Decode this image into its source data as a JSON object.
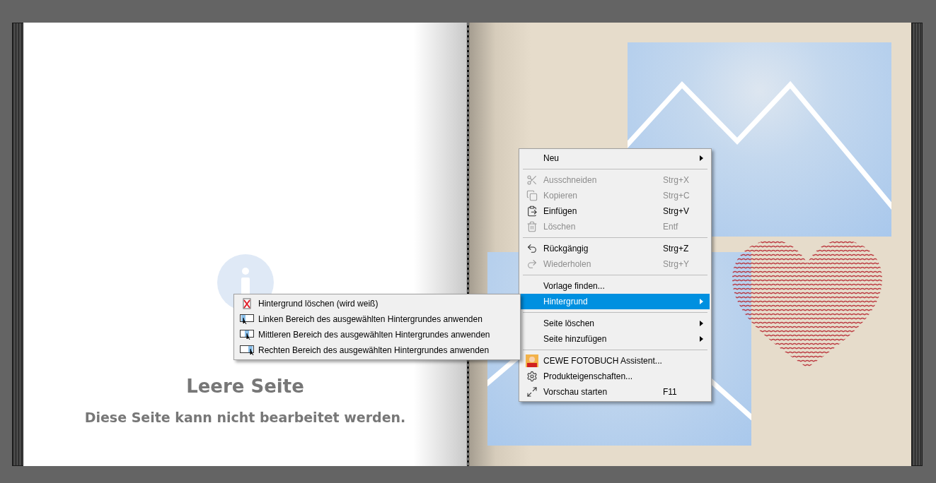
{
  "left_page": {
    "heading": "Leere Seite",
    "message": "Diese Seite kann nicht bearbeitet werden."
  },
  "context_menu": {
    "items": [
      {
        "kind": "item",
        "label": "Neu",
        "submenu": true,
        "disabled": false,
        "selected": false
      },
      {
        "kind": "separator"
      },
      {
        "kind": "item",
        "label": "Ausschneiden",
        "shortcut": "Strg+X",
        "submenu": false,
        "disabled": true,
        "selected": false
      },
      {
        "kind": "item",
        "label": "Kopieren",
        "shortcut": "Strg+C",
        "submenu": false,
        "disabled": true,
        "selected": false
      },
      {
        "kind": "item",
        "label": "Einfügen",
        "shortcut": "Strg+V",
        "submenu": false,
        "disabled": false,
        "selected": false
      },
      {
        "kind": "item",
        "label": "Löschen",
        "shortcut": "Entf",
        "submenu": false,
        "disabled": true,
        "selected": false
      },
      {
        "kind": "separator"
      },
      {
        "kind": "item",
        "label": "Rückgängig",
        "shortcut": "Strg+Z",
        "submenu": false,
        "disabled": false,
        "selected": false
      },
      {
        "kind": "item",
        "label": "Wiederholen",
        "shortcut": "Strg+Y",
        "submenu": false,
        "disabled": true,
        "selected": false
      },
      {
        "kind": "separator"
      },
      {
        "kind": "item",
        "label": "Vorlage finden...",
        "submenu": false,
        "disabled": false,
        "selected": false
      },
      {
        "kind": "item",
        "label": "Hintergrund",
        "submenu": true,
        "disabled": false,
        "selected": true
      },
      {
        "kind": "separator"
      },
      {
        "kind": "item",
        "label": "Seite löschen",
        "submenu": true,
        "disabled": false,
        "selected": false
      },
      {
        "kind": "item",
        "label": "Seite hinzufügen",
        "submenu": true,
        "disabled": false,
        "selected": false
      },
      {
        "kind": "separator"
      },
      {
        "kind": "item",
        "label": "CEWE FOTOBUCH Assistent...",
        "submenu": false,
        "disabled": false,
        "selected": false
      },
      {
        "kind": "item",
        "label": "Produkteigenschaften...",
        "submenu": false,
        "disabled": false,
        "selected": false
      },
      {
        "kind": "item",
        "label": "Vorschau starten",
        "shortcut": "F11",
        "submenu": false,
        "disabled": false,
        "selected": false
      }
    ]
  },
  "submenu": {
    "items": [
      {
        "label": "Hintergrund löschen (wird weiß)"
      },
      {
        "label": "Linken Bereich des ausgewählten Hintergrundes anwenden"
      },
      {
        "label": "Mittleren Bereich des ausgewählten Hintergrundes anwenden"
      },
      {
        "label": "Rechten Bereich des ausgewählten Hintergrundes anwenden"
      }
    ]
  }
}
